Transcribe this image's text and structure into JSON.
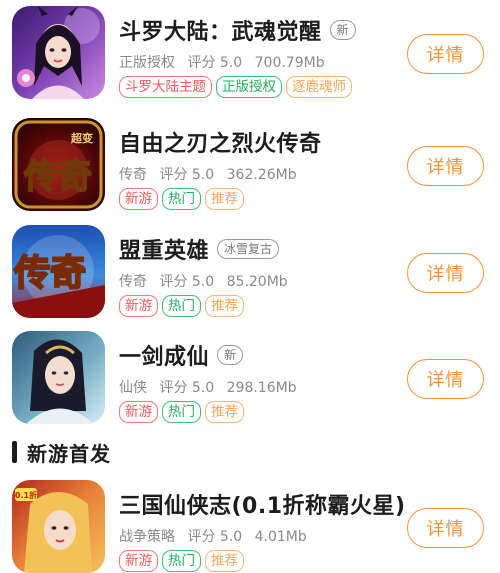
{
  "apps": [
    {
      "title": "斗罗大陆：武魂觉醒",
      "title_tag": "新",
      "category": "正版授权",
      "rating": "评分 5.0",
      "size": "700.79Mb",
      "tags": [
        {
          "label": "斗罗大陆主题",
          "color": "#f05a5a"
        },
        {
          "label": "正版授权",
          "color": "#1fb05a"
        },
        {
          "label": "逐鹿魂师",
          "color": "#f5a65b"
        }
      ],
      "button": "详情",
      "icon": "douluo-game-icon"
    },
    {
      "title": "自由之刃之烈火传奇",
      "category": "传奇",
      "rating": "评分 5.0",
      "size": "362.26Mb",
      "tags": [
        {
          "label": "新游",
          "color": "#f05a5a"
        },
        {
          "label": "热门",
          "color": "#1fb05a"
        },
        {
          "label": "推荐",
          "color": "#f5a65b"
        }
      ],
      "button": "详情",
      "icon": "chuanqi-game-icon",
      "icon_text_small": "超变",
      "icon_text_big": "传奇"
    },
    {
      "title": "盟重英雄",
      "title_tag": "冰雪复古",
      "category": "传奇",
      "rating": "评分 5.0",
      "size": "85.20Mb",
      "tags": [
        {
          "label": "新游",
          "color": "#f05a5a"
        },
        {
          "label": "热门",
          "color": "#1fb05a"
        },
        {
          "label": "推荐",
          "color": "#f5a65b"
        }
      ],
      "button": "详情",
      "icon": "mengzhong-game-icon",
      "icon_text_big": "传奇"
    },
    {
      "title": "一剑成仙",
      "title_tag": "新",
      "category": "仙侠",
      "rating": "评分 5.0",
      "size": "298.16Mb",
      "tags": [
        {
          "label": "新游",
          "color": "#f05a5a"
        },
        {
          "label": "热门",
          "color": "#1fb05a"
        },
        {
          "label": "推荐",
          "color": "#f5a65b"
        }
      ],
      "button": "详情",
      "icon": "yijian-game-icon"
    },
    {
      "title": "三国仙侠志(0.1折称霸火星)",
      "category": "战争策略",
      "rating": "评分 5.0",
      "size": "4.01Mb",
      "tags": [
        {
          "label": "新游",
          "color": "#f05a5a"
        },
        {
          "label": "热门",
          "color": "#1fb05a"
        },
        {
          "label": "推荐",
          "color": "#f5a65b"
        }
      ],
      "button": "详情",
      "icon": "sanguo-game-icon",
      "icon_text_small": "0.1折"
    }
  ],
  "section": {
    "title": "新游首发"
  },
  "colors": {
    "accent": "#f7923a",
    "tag_red": "#f05a5a",
    "tag_green": "#1fb05a",
    "tag_orange": "#f5a65b"
  }
}
